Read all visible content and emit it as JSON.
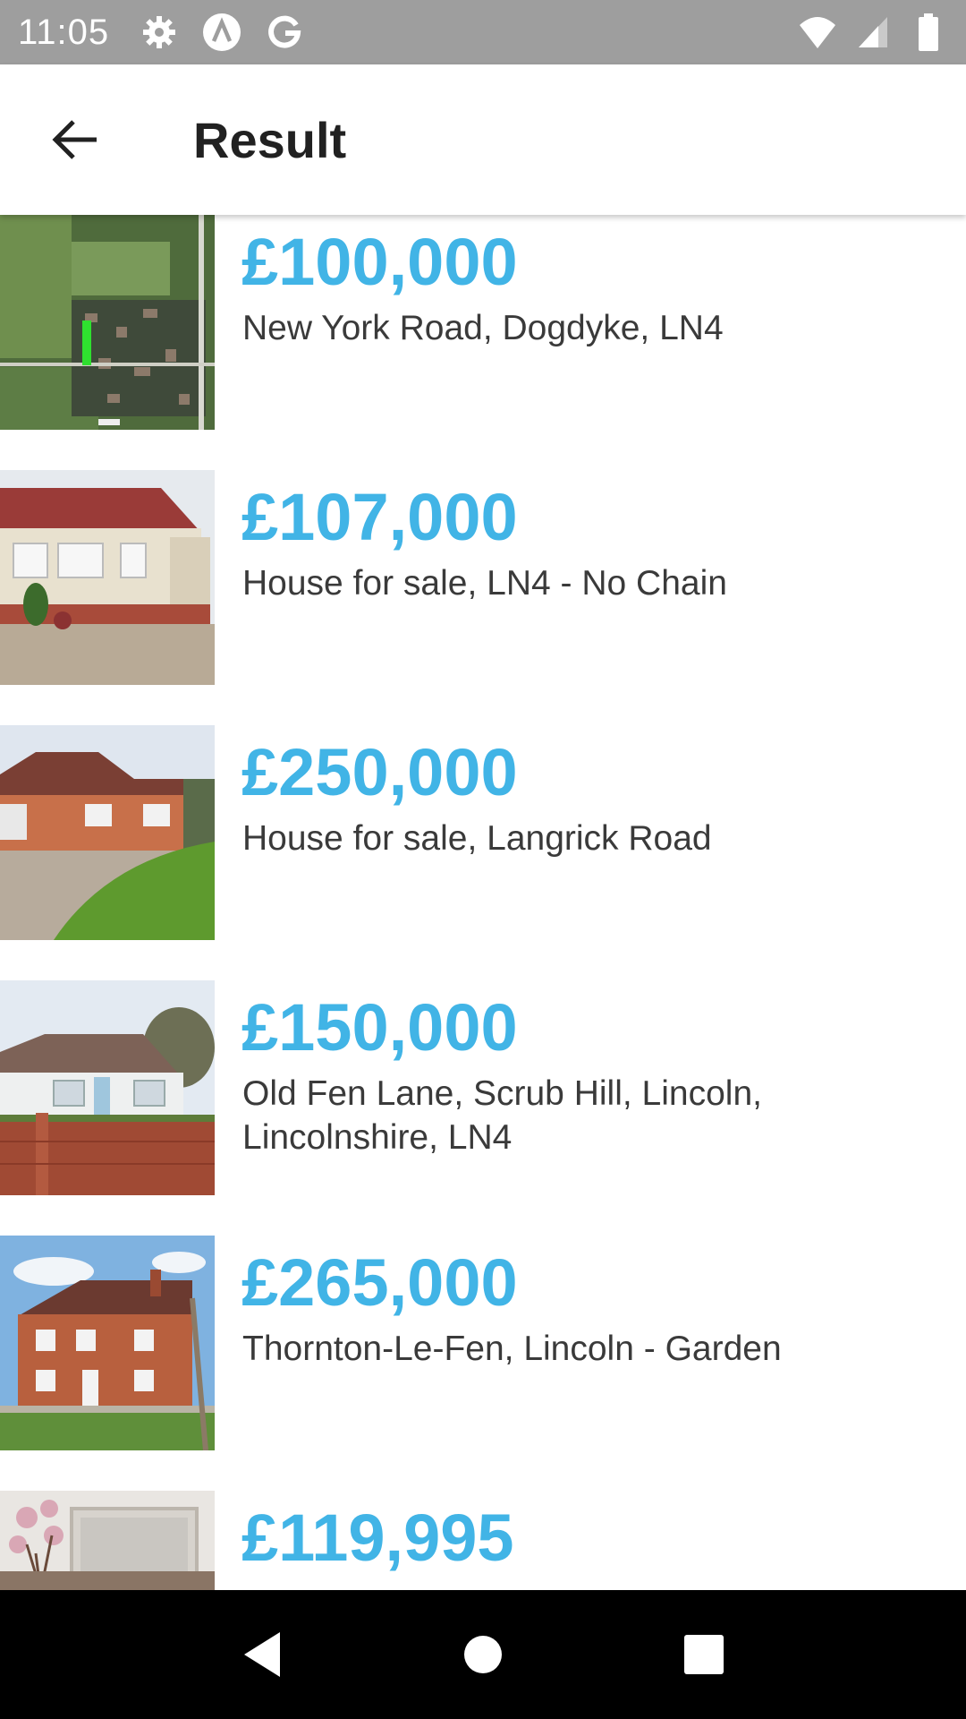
{
  "status_bar": {
    "time": "11:05",
    "left_icons": [
      "gear-icon",
      "a-badge-icon",
      "google-g-icon"
    ],
    "right_icons": [
      "wifi-icon",
      "signal-icon",
      "battery-icon"
    ]
  },
  "app_bar": {
    "back_icon": "arrow-left-icon",
    "title": "Result"
  },
  "accent_color": "#41b4e6",
  "listings": [
    {
      "price": "£100,000",
      "address": "New York Road, Dogdyke, LN4",
      "thumbnail": "aerial-map"
    },
    {
      "price": "£107,000",
      "address": "House for sale, LN4 - No Chain",
      "thumbnail": "park-home"
    },
    {
      "price": "£250,000",
      "address": "House for sale, Langrick Road",
      "thumbnail": "bungalow-lawn"
    },
    {
      "price": "£150,000",
      "address": "Old Fen Lane, Scrub Hill, Lincoln, Lincolnshire, LN4",
      "thumbnail": "white-bungalow-wall"
    },
    {
      "price": "£265,000",
      "address": "Thornton-Le-Fen, Lincoln - Garden",
      "thumbnail": "brick-house"
    },
    {
      "price": "£119,995",
      "address": "",
      "thumbnail": "interior-flowers"
    }
  ],
  "nav_bar": {
    "buttons": [
      "back-triangle-icon",
      "home-circle-icon",
      "recents-square-icon"
    ]
  }
}
